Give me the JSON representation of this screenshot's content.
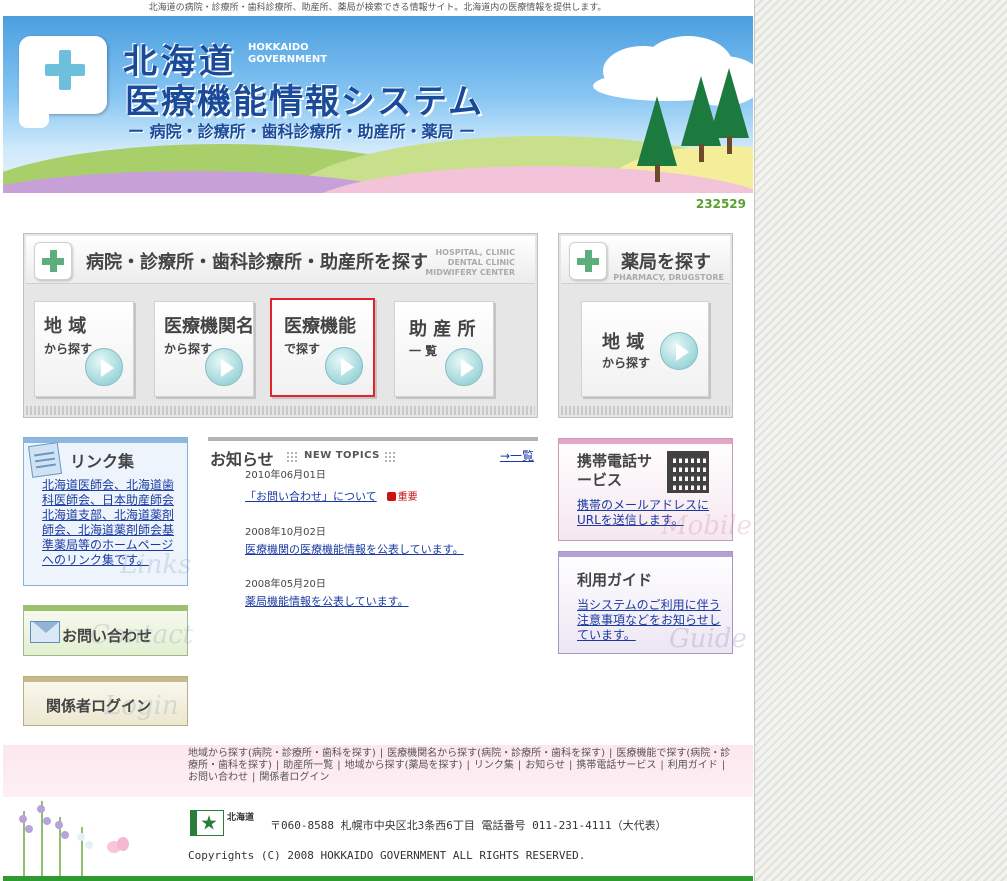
{
  "tagline": "北海道の病院・診療所・歯科診療所、助産所、薬局が検索できる情報サイト。北海道内の医療情報を提供します。",
  "header": {
    "title_line1": "北海道",
    "title_en_line1": "HOKKAIDO",
    "title_en_line2": "GOVERNMENT",
    "title_line2": "医療機能情報システム",
    "subtitle": "ー 病院・診療所・歯科診療所・助産所・薬局 ー"
  },
  "counter": "232529",
  "hospital_search": {
    "title": "病院・診療所・歯科診療所・助産所を探す",
    "en_line1": "HOSPITAL, CLINIC",
    "en_line2": "DENTAL CLINIC",
    "en_line3": "MIDWIFERY CENTER",
    "buttons": [
      {
        "main": "地 域",
        "sub": "から探す"
      },
      {
        "main": "医療機関名",
        "sub": "から探す"
      },
      {
        "main": "医療機能",
        "sub": "で探す"
      },
      {
        "main": "助 産 所",
        "sub": "一 覧"
      }
    ]
  },
  "pharmacy_search": {
    "title": "薬局を探す",
    "en": "PHARMACY, DRUGSTORE",
    "button_main": "地 域",
    "button_sub": "から探す"
  },
  "links_box": {
    "title": "リンク集",
    "description": "北海道医師会、北海道歯科医師会、日本助産師会北海道支部、北海道薬剤師会、北海道薬剤師会基準薬局等のホームページへのリンク集です。",
    "watermark": "Links"
  },
  "contact_box": {
    "label": "お問い合わせ",
    "watermark": "Contact"
  },
  "login_box": {
    "label": "関係者ログイン",
    "watermark": "Login"
  },
  "news": {
    "title": "お知らせ",
    "subtitle": "NEW TOPICS",
    "all_link": "→一覧",
    "items": [
      {
        "date": "2010年06月01日",
        "title": "「お問い合わせ」について",
        "badge": "重要"
      },
      {
        "date": "2008年10月02日",
        "title": "医療機関の医療機能情報を公表しています。"
      },
      {
        "date": "2008年05月20日",
        "title": "薬局機能情報を公表しています。"
      }
    ]
  },
  "mobile_box": {
    "title": "携帯電話サービス",
    "description": "携帯のメールアドレスにURLを送信します。",
    "watermark": "Mobile"
  },
  "guide_box": {
    "title": "利用ガイド",
    "description": "当システムのご利用に伴う注意事項などをお知らせしています。",
    "watermark": "Guide"
  },
  "footer": {
    "links": [
      "地域から探す(病院・診療所・歯科を探す)",
      "医療機関名から探す(病院・診療所・歯科を探す)",
      "医療機能で探す(病院・診療所・歯科を探す)",
      "助産所一覧",
      "地域から探す(薬局を探す)",
      "リンク集",
      "お知らせ",
      "携帯電話サービス",
      "利用ガイド",
      "お問い合わせ",
      "関係者ログイン"
    ],
    "gov_label": "北海道",
    "address": "〒060-8588 札幌市中央区北3条西6丁目 電話番号 011-231-4111（大代表）",
    "copyright": "Copyrights (C) 2008 HOKKAIDO GOVERNMENT ALL RIGHTS RESERVED."
  }
}
